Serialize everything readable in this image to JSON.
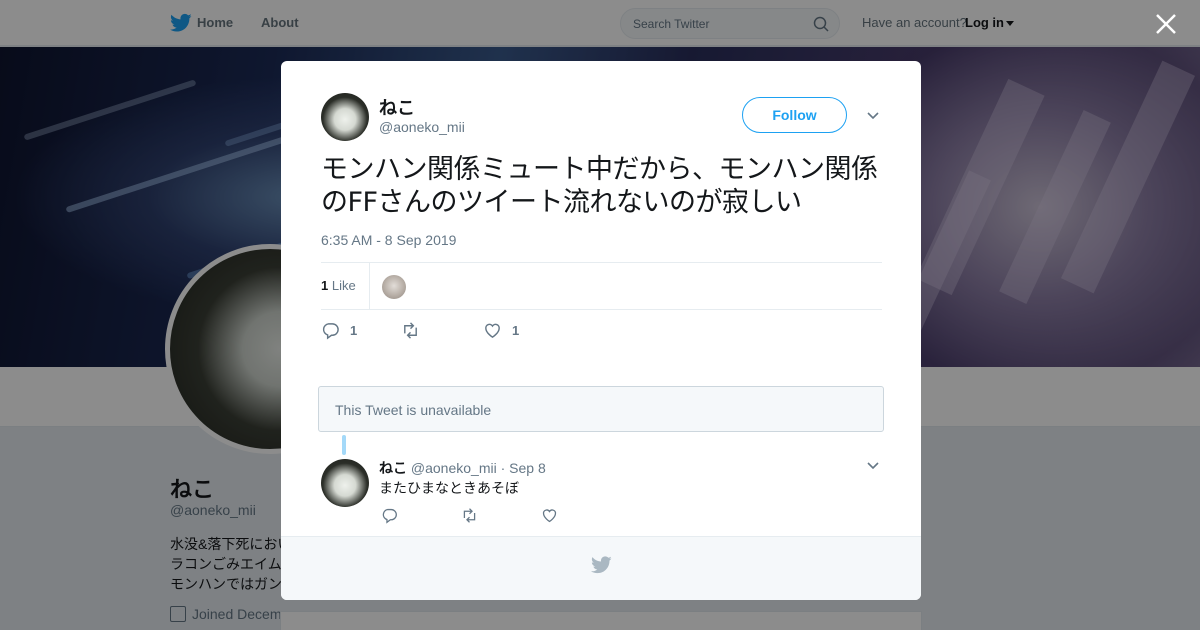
{
  "topbar": {
    "home_label": "Home",
    "about_label": "About",
    "search_placeholder": "Search Twitter",
    "account_prompt": "Have an account?",
    "login_label": "Log in"
  },
  "profile": {
    "name": "ねこ",
    "handle": "@aoneko_mii",
    "bio_lines": [
      "水没&落下死におい",
      "ラコンごみエイム",
      "モンハンではガン"
    ],
    "joined": "Joined Decem"
  },
  "tweet": {
    "author_name": "ねこ",
    "author_handle": "@aoneko_mii",
    "follow_label": "Follow",
    "text": "モンハン関係ミュート中だから、モンハン関係のFFさんのツイート流れないのが寂しい",
    "timestamp": "6:35 AM - 8 Sep 2019",
    "like_count": "1",
    "like_word": "Like",
    "actions": {
      "reply_count": "1",
      "like_count": "1"
    }
  },
  "quoted": {
    "unavailable_text": "This Tweet is unavailable"
  },
  "reply": {
    "author_name": "ねこ",
    "author_handle": "@aoneko_mii",
    "date": "· Sep 8",
    "text": "またひまなときあそぼ"
  },
  "colors": {
    "brand": "#1da1f2",
    "muted": "#657786",
    "text": "#14171a"
  }
}
